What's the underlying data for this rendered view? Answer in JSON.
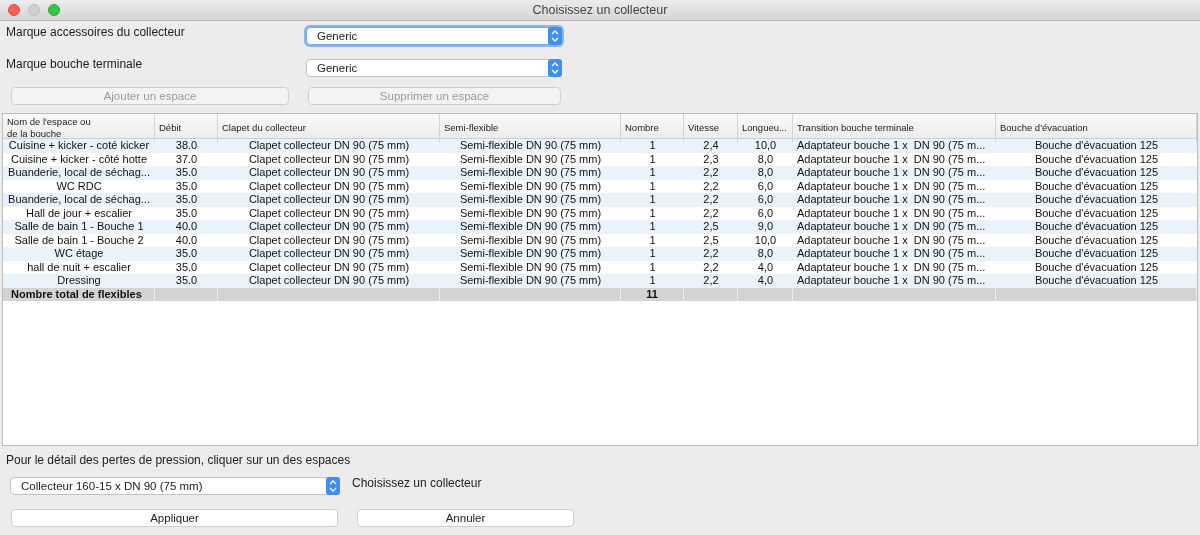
{
  "window": {
    "title": "Choisissez un collecteur"
  },
  "brand_fields": [
    {
      "label": "Marque accessoires du collecteur",
      "value": "Generic",
      "focused": true
    },
    {
      "label": "Marque bouche terminale",
      "value": "Generic",
      "focused": false
    }
  ],
  "actions": [
    {
      "label": "Ajouter un espace",
      "disabled": true
    },
    {
      "label": "Supprimer un espace",
      "disabled": true
    }
  ],
  "table": {
    "columns": [
      "Nom de l'espace ou de la bouche",
      "Débit",
      "Clapet du collecteur",
      "Semi-flexible",
      "Nombre",
      "Vitesse",
      "Longueu...",
      "Transition bouche terminale",
      "Bouche d'évacuation"
    ],
    "rows": [
      [
        "Cuisine + kicker - coté kicker",
        "38.0",
        "Clapet collecteur DN 90 (75 mm)",
        "Semi-flexible DN 90 (75 mm)",
        "1",
        "2,4",
        "10,0",
        "Adaptateur bouche 1 x  DN 90 (75 m...",
        "Bouche d'évacuation 125"
      ],
      [
        "Cuisine + kicker - côté hotte",
        "37.0",
        "Clapet collecteur DN 90 (75 mm)",
        "Semi-flexible DN 90 (75 mm)",
        "1",
        "2,3",
        "8,0",
        "Adaptateur bouche 1 x  DN 90 (75 m...",
        "Bouche d'évacuation 125"
      ],
      [
        "Buanderie, local de séchag...",
        "35.0",
        "Clapet collecteur DN 90 (75 mm)",
        "Semi-flexible DN 90 (75 mm)",
        "1",
        "2,2",
        "8,0",
        "Adaptateur bouche 1 x  DN 90 (75 m...",
        "Bouche d'évacuation 125"
      ],
      [
        "WC RDC",
        "35.0",
        "Clapet collecteur DN 90 (75 mm)",
        "Semi-flexible DN 90 (75 mm)",
        "1",
        "2,2",
        "6,0",
        "Adaptateur bouche 1 x  DN 90 (75 m...",
        "Bouche d'évacuation 125"
      ],
      [
        "Buanderie, local de séchag...",
        "35.0",
        "Clapet collecteur DN 90 (75 mm)",
        "Semi-flexible DN 90 (75 mm)",
        "1",
        "2,2",
        "6,0",
        "Adaptateur bouche 1 x  DN 90 (75 m...",
        "Bouche d'évacuation 125"
      ],
      [
        "Hall de jour + escalier",
        "35.0",
        "Clapet collecteur DN 90 (75 mm)",
        "Semi-flexible DN 90 (75 mm)",
        "1",
        "2,2",
        "6,0",
        "Adaptateur bouche 1 x  DN 90 (75 m...",
        "Bouche d'évacuation 125"
      ],
      [
        "Salle de bain 1 - Bouche 1",
        "40.0",
        "Clapet collecteur DN 90 (75 mm)",
        "Semi-flexible DN 90 (75 mm)",
        "1",
        "2,5",
        "9,0",
        "Adaptateur bouche 1 x  DN 90 (75 m...",
        "Bouche d'évacuation 125"
      ],
      [
        "Salle de bain 1 - Bouche 2",
        "40.0",
        "Clapet collecteur DN 90 (75 mm)",
        "Semi-flexible DN 90 (75 mm)",
        "1",
        "2,5",
        "10,0",
        "Adaptateur bouche 1 x  DN 90 (75 m...",
        "Bouche d'évacuation 125"
      ],
      [
        "WC étage",
        "35.0",
        "Clapet collecteur DN 90 (75 mm)",
        "Semi-flexible DN 90 (75 mm)",
        "1",
        "2,2",
        "8,0",
        "Adaptateur bouche 1 x  DN 90 (75 m...",
        "Bouche d'évacuation 125"
      ],
      [
        "hall de nuit + escalier",
        "35.0",
        "Clapet collecteur DN 90 (75 mm)",
        "Semi-flexible DN 90 (75 mm)",
        "1",
        "2,2",
        "4,0",
        "Adaptateur bouche 1 x  DN 90 (75 m...",
        "Bouche d'évacuation 125"
      ],
      [
        "Dressing",
        "35.0",
        "Clapet collecteur DN 90 (75 mm)",
        "Semi-flexible DN 90 (75 mm)",
        "1",
        "2,2",
        "4,0",
        "Adaptateur bouche 1 x  DN 90 (75 m...",
        "Bouche d'évacuation 125"
      ]
    ],
    "total_row": {
      "label": "Nombre total de flexibles",
      "count": "11"
    }
  },
  "footer": {
    "hint": "Pour le détail des pertes de pression, cliquer sur un des espaces",
    "collector_select": {
      "value": "Collecteur 160-15 x DN 90 (75 mm)",
      "label": "Choisissez un collecteur"
    },
    "buttons": [
      "Appliquer",
      "Annuler"
    ]
  }
}
